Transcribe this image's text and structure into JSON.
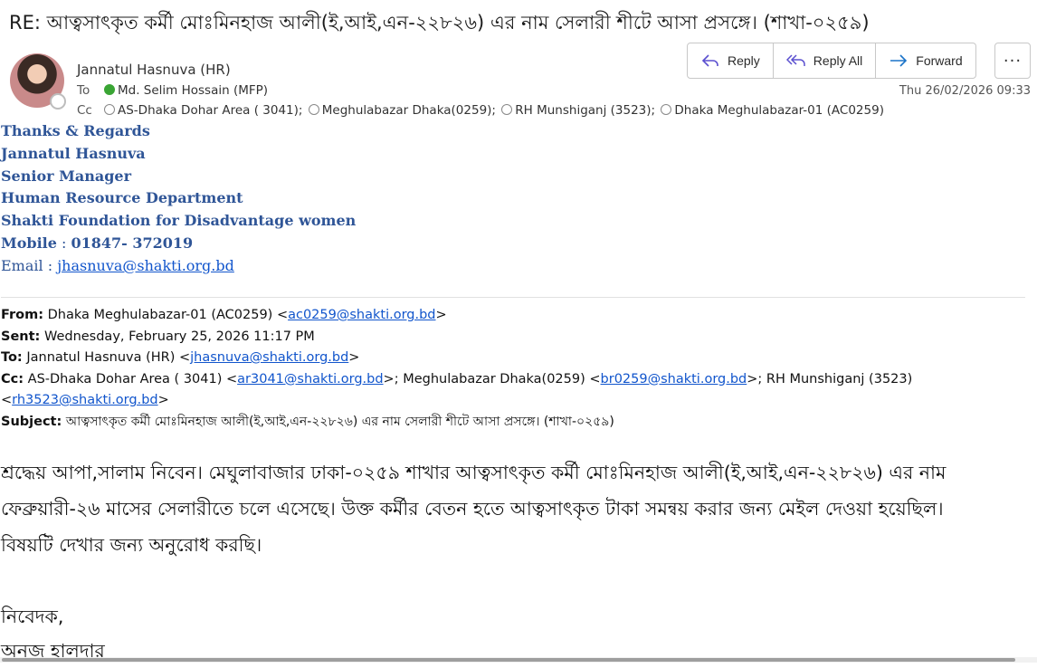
{
  "message": {
    "subject": "RE: আত্বসাৎকৃত কর্মী মোঃমিনহাজ আলী(ই,আই,এন-২২৮২৬) এর নাম সেলারী শীটে আসা প্রসঙ্গে। (শাখা-০২৫৯)",
    "sender": "Jannatul Hasnuva (HR)",
    "to_label": "To",
    "to": "Md. Selim Hossain (MFP)",
    "cc_label": "Cc",
    "cc": [
      "AS-Dhaka Dohar Area ( 3041);",
      "Meghulabazar  Dhaka(0259);",
      "RH Munshiganj (3523);",
      "Dhaka Meghulabazar-01 (AC0259)"
    ],
    "date": "Thu 26/02/2026 09:33"
  },
  "actions": {
    "reply": "Reply",
    "reply_all": "Reply All",
    "forward": "Forward",
    "more": "···"
  },
  "signature": {
    "line1": "Thanks & Regards",
    "line2": "Jannatul Hasnuva",
    "line3": "Senior Manager",
    "line4": "Human Resource Department",
    "line5": "Shakti Foundation for Disadvantage women",
    "mobile_label": "Mobile",
    "mobile": "01847- 372019",
    "email_label": "Email",
    "email": "jhasnuva@shakti.org.bd"
  },
  "quoted": {
    "from_label": "From:",
    "from_name": "Dhaka Meghulabazar-01 (AC0259) <",
    "from_email": "ac0259@shakti.org.bd",
    "sent_label": "Sent:",
    "sent": "Wednesday, February 25, 2026 11:17 PM",
    "to_label": "To:",
    "to_name": "Jannatul Hasnuva (HR) <",
    "to_email": "jhasnuva@shakti.org.bd",
    "cc_label": "Cc:",
    "cc1_name": "AS-Dhaka Dohar Area ( 3041) <",
    "cc1_email": "ar3041@shakti.org.bd",
    "cc2_name": ">; Meghulabazar Dhaka(0259) <",
    "cc2_email": "br0259@shakti.org.bd",
    "cc3_name": ">; RH Munshiganj (3523)",
    "cc3_email": "rh3523@shakti.org.bd",
    "subject_label": "Subject:",
    "subject": "আত্বসাৎকৃত কর্মী মোঃমিনহাজ আলী(ই,আই,এন-২২৮২৬) এর নাম সেলারী শীটে আসা প্রসঙ্গে। (শাখা-০২৫৯)"
  },
  "body": {
    "line1": "শ্রদ্ধেয় আপা,সালাম নিবেন। মেঘুলাবাজার ঢাকা-০২৫৯ শাখার আত্বসাৎকৃত কর্মী মোঃমিনহাজ আলী(ই,আই,এন-২২৮২৬) এর নাম",
    "line2": "ফেব্রুয়ারী-২৬ মাসের সেলারীতে চলে এসেছে। উক্ত কর্মীর বেতন হতে আত্বসাৎকৃত টাকা সমন্বয় করার জন্য মেইল দেওয়া হয়েছিল।",
    "line3": "বিষয়টি দেখার জন্য অনুরোধ করছি।",
    "closing": "নিবেদক,",
    "signer": "অনজ হালদার"
  }
}
